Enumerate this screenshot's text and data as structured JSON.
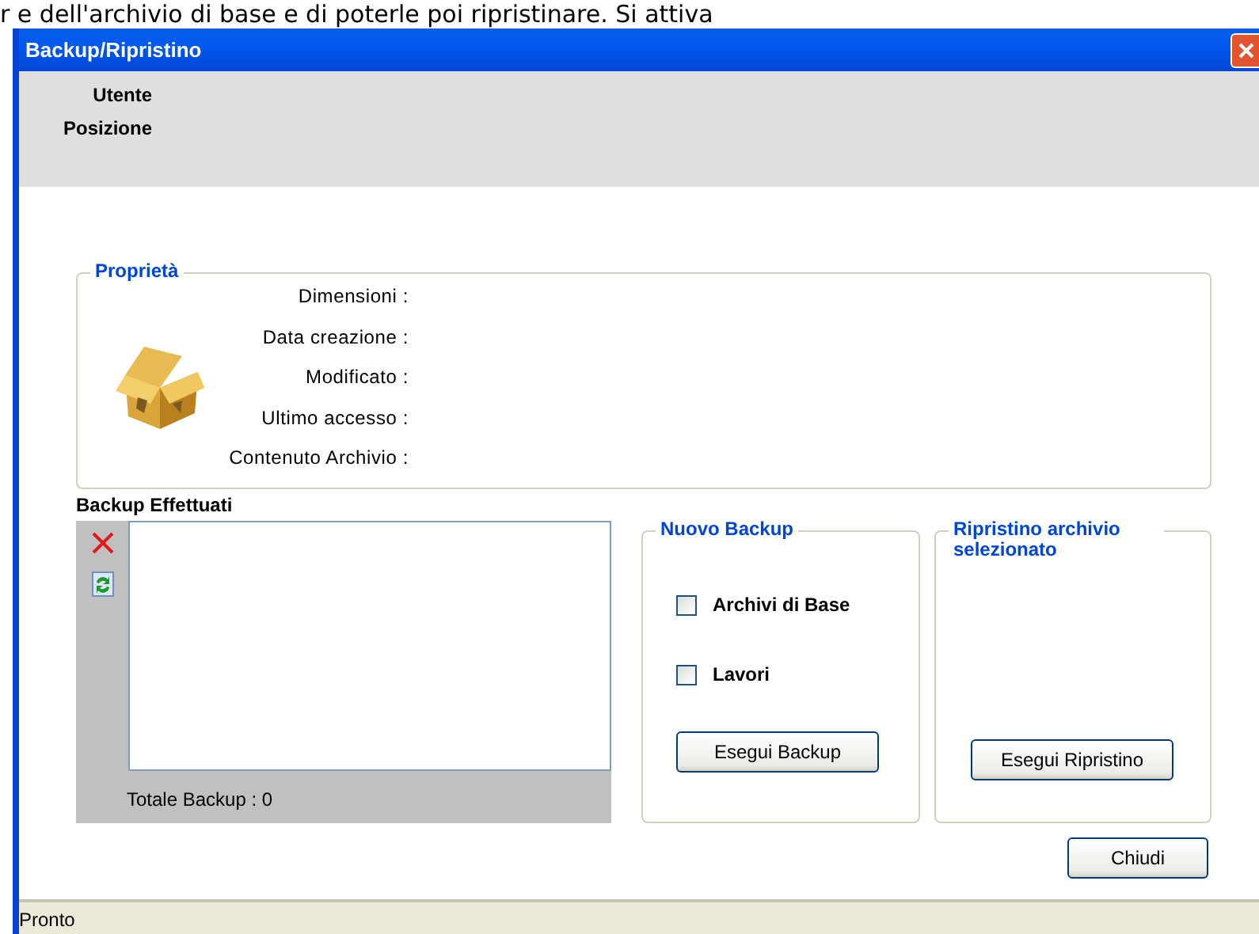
{
  "background_text": "r e dell'archivio di base e di poterle poi ripristinare. Si attiva",
  "window": {
    "title": "Backup/Ripristino"
  },
  "header": {
    "fields": [
      {
        "label": "Utente"
      },
      {
        "label": "Posizione"
      }
    ]
  },
  "properties": {
    "title": "Proprietà",
    "fields": [
      {
        "label": "Dimensioni :"
      },
      {
        "label": "Data creazione :"
      },
      {
        "label": "Modificato :"
      },
      {
        "label": "Ultimo accesso :"
      },
      {
        "label": "Contenuto Archivio :"
      }
    ]
  },
  "backups": {
    "title": "Backup Effettuati",
    "total": "Totale Backup : 0"
  },
  "new_backup": {
    "title": "Nuovo Backup",
    "options": [
      {
        "label": "Archivi di Base",
        "checked": false
      },
      {
        "label": "Lavori",
        "checked": false
      }
    ],
    "button": {
      "label": "Esegui Backup"
    }
  },
  "restore": {
    "title": "Ripristino archivio selezionato",
    "button": {
      "label": "Esegui Ripristino"
    }
  },
  "close_button": {
    "label": "Chiudi"
  },
  "status_bar": {
    "text": "Pronto"
  }
}
